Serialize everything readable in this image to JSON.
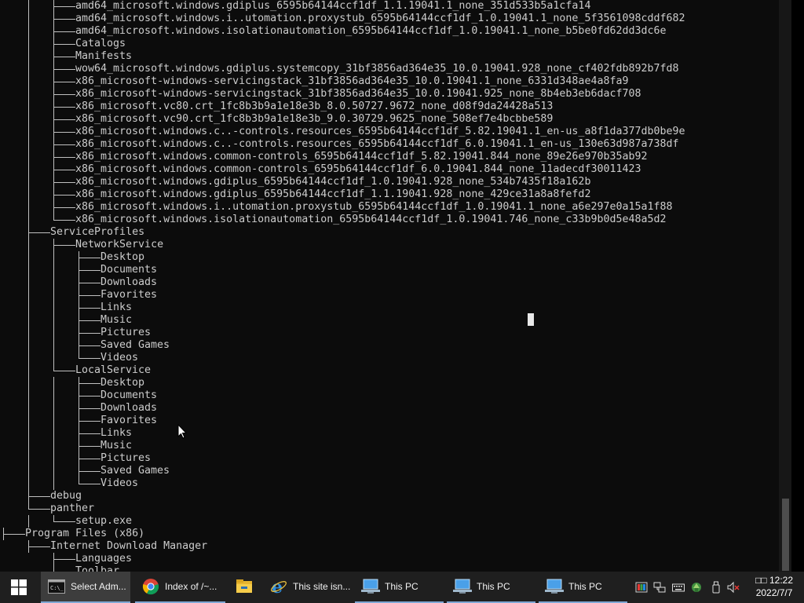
{
  "console": {
    "lines": [
      {
        "indent": 3,
        "text": "amd64_microsoft.windows.gdiplus_6595b64144ccf1df_1.1.19041.1_none_351d533b5a1cfa14"
      },
      {
        "indent": 3,
        "text": "amd64_microsoft.windows.i..utomation.proxystub_6595b64144ccf1df_1.0.19041.1_none_5f3561098cddf682"
      },
      {
        "indent": 3,
        "text": "amd64_microsoft.windows.isolationautomation_6595b64144ccf1df_1.0.19041.1_none_b5be0fd62dd3dc6e"
      },
      {
        "indent": 3,
        "text": "Catalogs"
      },
      {
        "indent": 3,
        "text": "Manifests"
      },
      {
        "indent": 3,
        "text": "wow64_microsoft.windows.gdiplus.systemcopy_31bf3856ad364e35_10.0.19041.928_none_cf402fdb892b7fd8"
      },
      {
        "indent": 3,
        "text": "x86_microsoft-windows-servicingstack_31bf3856ad364e35_10.0.19041.1_none_6331d348ae4a8fa9"
      },
      {
        "indent": 3,
        "text": "x86_microsoft-windows-servicingstack_31bf3856ad364e35_10.0.19041.925_none_8b4eb3eb6dacf708"
      },
      {
        "indent": 3,
        "text": "x86_microsoft.vc80.crt_1fc8b3b9a1e18e3b_8.0.50727.9672_none_d08f9da24428a513"
      },
      {
        "indent": 3,
        "text": "x86_microsoft.vc90.crt_1fc8b3b9a1e18e3b_9.0.30729.9625_none_508ef7e4bcbbe589"
      },
      {
        "indent": 3,
        "text": "x86_microsoft.windows.c..-controls.resources_6595b64144ccf1df_5.82.19041.1_en-us_a8f1da377db0be9e"
      },
      {
        "indent": 3,
        "text": "x86_microsoft.windows.c..-controls.resources_6595b64144ccf1df_6.0.19041.1_en-us_130e63d987a738df"
      },
      {
        "indent": 3,
        "text": "x86_microsoft.windows.common-controls_6595b64144ccf1df_5.82.19041.844_none_89e26e970b35ab92"
      },
      {
        "indent": 3,
        "text": "x86_microsoft.windows.common-controls_6595b64144ccf1df_6.0.19041.844_none_11adecdf30011423"
      },
      {
        "indent": 3,
        "text": "x86_microsoft.windows.gdiplus_6595b64144ccf1df_1.0.19041.928_none_534b7435f18a162b"
      },
      {
        "indent": 3,
        "text": "x86_microsoft.windows.gdiplus_6595b64144ccf1df_1.1.19041.928_none_429ce31a8a8fefd2"
      },
      {
        "indent": 3,
        "text": "x86_microsoft.windows.i..utomation.proxystub_6595b64144ccf1df_1.0.19041.1_none_a6e297e0a15a1f88"
      },
      {
        "indent": 3,
        "text": "x86_microsoft.windows.isolationautomation_6595b64144ccf1df_1.0.19041.746_none_c33b9b0d5e48a5d2",
        "last": true
      },
      {
        "indent": 2,
        "text": "ServiceProfiles"
      },
      {
        "indent": 3,
        "text": "NetworkService"
      },
      {
        "indent": 4,
        "text": "Desktop"
      },
      {
        "indent": 4,
        "text": "Documents"
      },
      {
        "indent": 4,
        "text": "Downloads"
      },
      {
        "indent": 4,
        "text": "Favorites"
      },
      {
        "indent": 4,
        "text": "Links"
      },
      {
        "indent": 4,
        "text": "Music"
      },
      {
        "indent": 4,
        "text": "Pictures"
      },
      {
        "indent": 4,
        "text": "Saved Games"
      },
      {
        "indent": 4,
        "text": "Videos",
        "last": true
      },
      {
        "indent": 3,
        "text": "LocalService",
        "last": true
      },
      {
        "indent": 4,
        "text": "Desktop"
      },
      {
        "indent": 4,
        "text": "Documents"
      },
      {
        "indent": 4,
        "text": "Downloads"
      },
      {
        "indent": 4,
        "text": "Favorites"
      },
      {
        "indent": 4,
        "text": "Links"
      },
      {
        "indent": 4,
        "text": "Music"
      },
      {
        "indent": 4,
        "text": "Pictures"
      },
      {
        "indent": 4,
        "text": "Saved Games"
      },
      {
        "indent": 4,
        "text": "Videos",
        "last": true
      },
      {
        "indent": 2,
        "text": "debug"
      },
      {
        "indent": 2,
        "text": "panther",
        "last": true
      },
      {
        "indent": 3,
        "text": "setup.exe",
        "last": true
      },
      {
        "indent": 1,
        "text": "Program Files (x86)"
      },
      {
        "indent": 2,
        "text": "Internet Download Manager"
      },
      {
        "indent": 3,
        "text": "Languages"
      },
      {
        "indent": 3,
        "text": "Toolbar"
      }
    ]
  },
  "taskbar": {
    "tasks": [
      {
        "label": "Select Adm...",
        "icon": "cmd-icon",
        "state": "active"
      },
      {
        "label": "Index of /~...",
        "icon": "chrome-icon",
        "state": "grouped"
      },
      {
        "label": "",
        "icon": "file-explorer-icon",
        "state": "normal"
      },
      {
        "label": "This site isn...",
        "icon": "internet-explorer-icon",
        "state": "normal"
      },
      {
        "label": "This PC",
        "icon": "this-pc-icon",
        "state": "grouped"
      },
      {
        "label": "This PC",
        "icon": "this-pc-icon",
        "state": "grouped"
      },
      {
        "label": "This PC",
        "icon": "this-pc-icon",
        "state": "grouped"
      }
    ],
    "tray_icons": [
      "color-app-icon",
      "network-icon",
      "keyboard-icon",
      "green-app-icon",
      "usb-icon",
      "volume-muted-icon"
    ],
    "clock": {
      "line1": "□□ 12:22",
      "line2": "2022/7/7"
    }
  },
  "colors": {
    "console_bg": "#0c0c0c",
    "console_text": "#cccccc",
    "taskbar_bg": "#1f1f1f",
    "accent": "#7fa7d4"
  }
}
